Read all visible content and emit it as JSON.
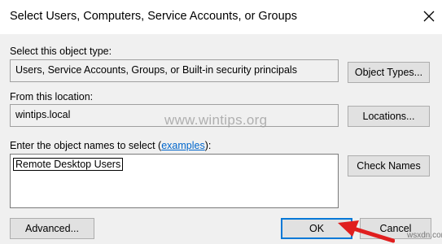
{
  "window": {
    "title": "Select Users, Computers, Service Accounts, or Groups"
  },
  "object_type": {
    "label": "Select this object type:",
    "value": "Users, Service Accounts, Groups, or Built-in security principals",
    "button": "Object Types..."
  },
  "location": {
    "label": "From this location:",
    "value": "wintips.local",
    "button": "Locations..."
  },
  "names": {
    "label_prefix": "Enter the object names to select (",
    "link": "examples",
    "label_suffix": "):",
    "entered_name": "Remote Desktop Users",
    "check_button": "Check Names"
  },
  "footer": {
    "advanced": "Advanced...",
    "ok": "OK",
    "cancel": "Cancel"
  },
  "watermark": {
    "text": "www.wintips.org",
    "corner": "wsxdn.com"
  },
  "colors": {
    "accent": "#0078d7",
    "link": "#0066cc",
    "arrow": "#e01e1e"
  },
  "icons": {
    "close": "close-icon",
    "arrow": "red-arrow-icon"
  }
}
